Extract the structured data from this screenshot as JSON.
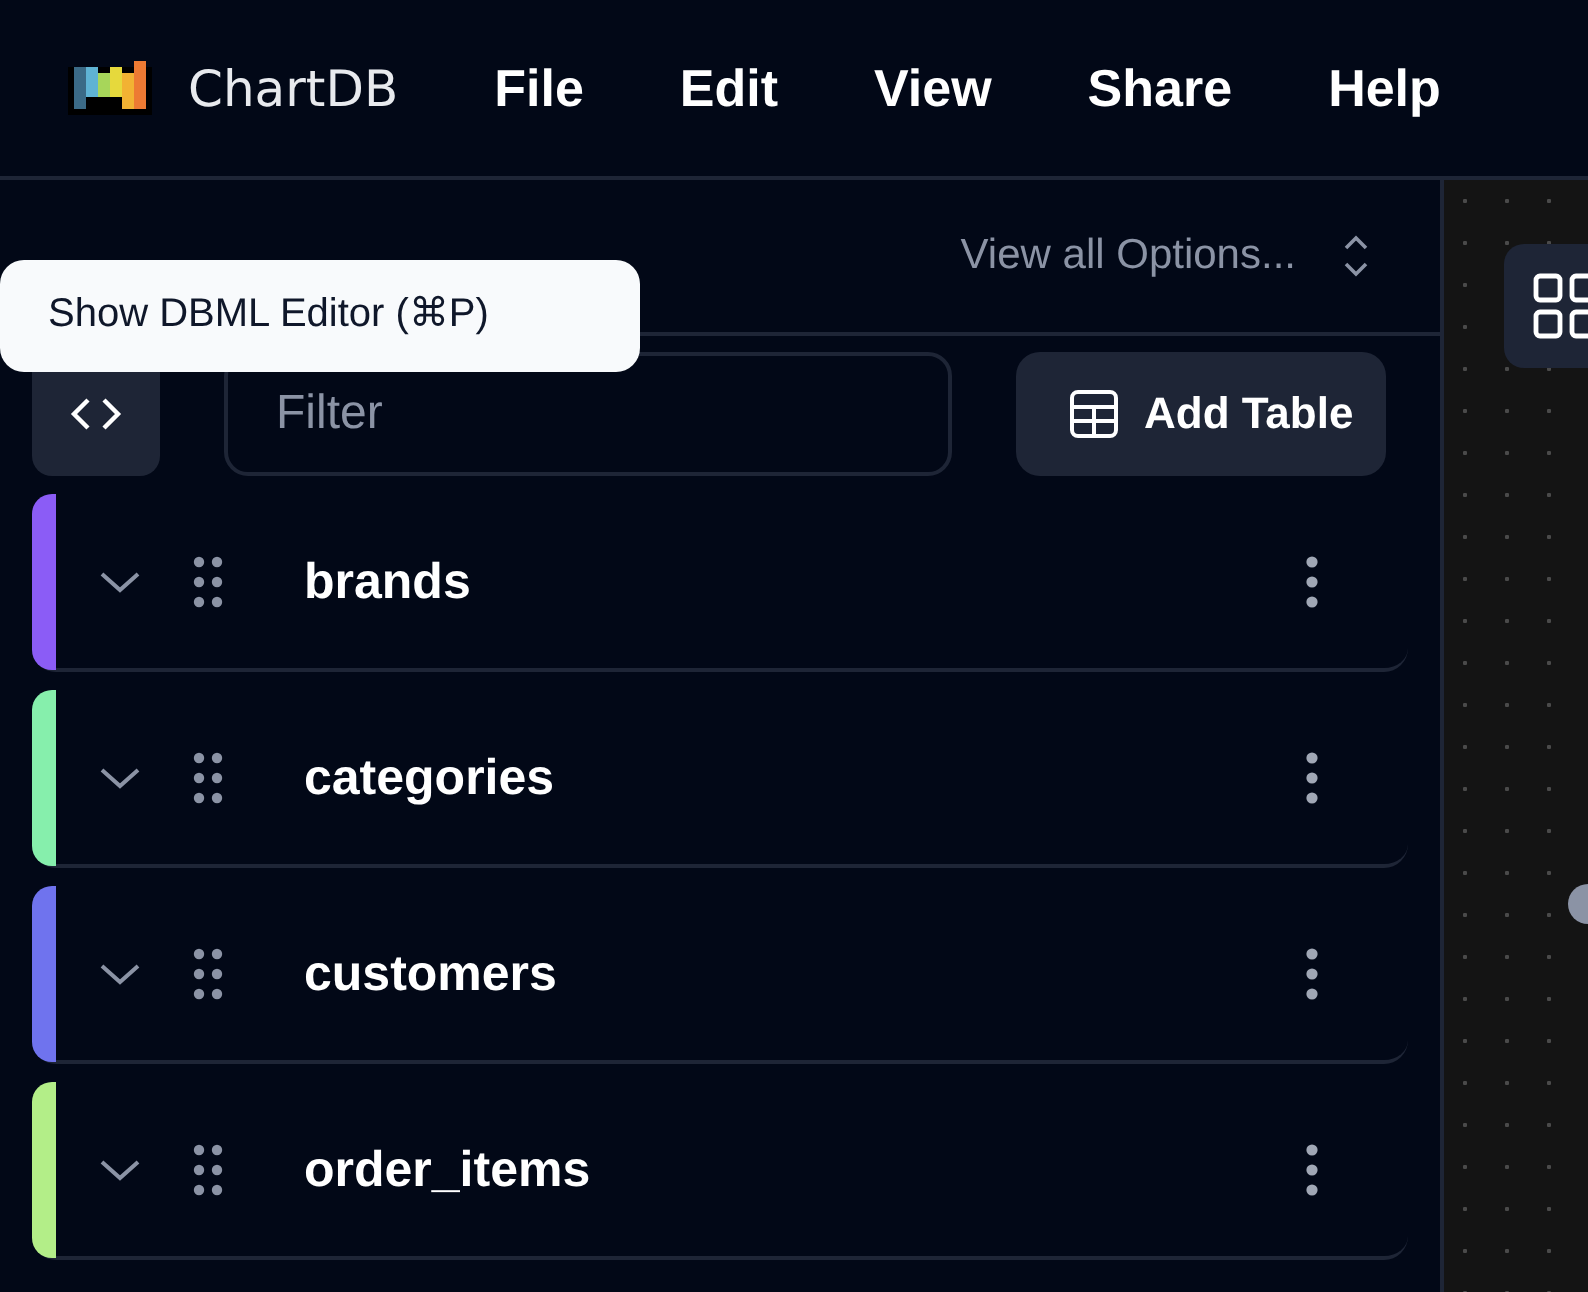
{
  "app": {
    "name": "ChartDB"
  },
  "menu": [
    "File",
    "Edit",
    "View",
    "Share",
    "Help"
  ],
  "sidebar": {
    "options": "View all Options...",
    "filter": {
      "placeholder": "Filter"
    },
    "add_button": "Add Table",
    "tables": [
      {
        "name": "brands",
        "color": "#8b5cf6"
      },
      {
        "name": "categories",
        "color": "#86efac"
      },
      {
        "name": "customers",
        "color": "#6f73ee"
      },
      {
        "name": "order_items",
        "color": "#b3ee88"
      }
    ]
  },
  "tooltip": "Show DBML Editor (⌘P)"
}
